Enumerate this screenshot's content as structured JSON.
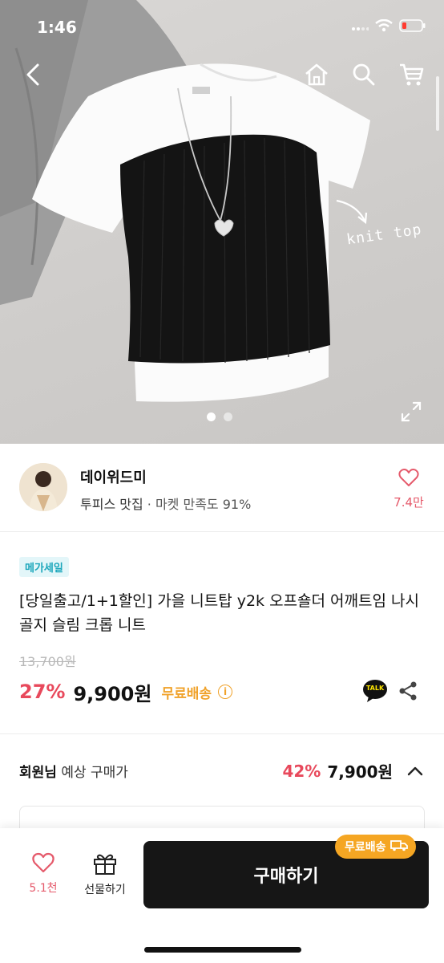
{
  "status": {
    "time": "1:46"
  },
  "nav": {
    "back_icon": "chevron-left-icon",
    "home_icon": "home-icon",
    "search_icon": "search-icon",
    "cart_icon": "cart-icon"
  },
  "gallery": {
    "image_text": "knit top",
    "page_count": 2,
    "active_page": 1,
    "expand_icon": "expand-icon"
  },
  "seller": {
    "name": "데이위드미",
    "tag": "투피스 맛집",
    "rating_text": "· 마켓 만족도 91%",
    "likes": "7.4만"
  },
  "product": {
    "badge": "메가세일",
    "title": "[당일출고/1+1할인] 가을 니트탑 y2k 오프숄더 어깨트임 나시 골지 슬림 크롭 니트",
    "original_price": "13,700원",
    "discount": "27%",
    "price": "9,900원",
    "shipping": "무료배송",
    "info_icon": "i",
    "talk_label": "TALK"
  },
  "member": {
    "label_bold": "회원님",
    "label": " 예상 구매가",
    "discount": "42%",
    "price": "7,900원"
  },
  "bottom": {
    "likes": "5.1천",
    "gift_label": "선물하기",
    "buy_label": "구매하기",
    "ship_pill": "무료배송"
  },
  "colors": {
    "accent_red": "#e8495c",
    "shipping_orange": "#f0a22a",
    "badge_teal": "#1aa6bb",
    "buy_button": "#161616"
  }
}
